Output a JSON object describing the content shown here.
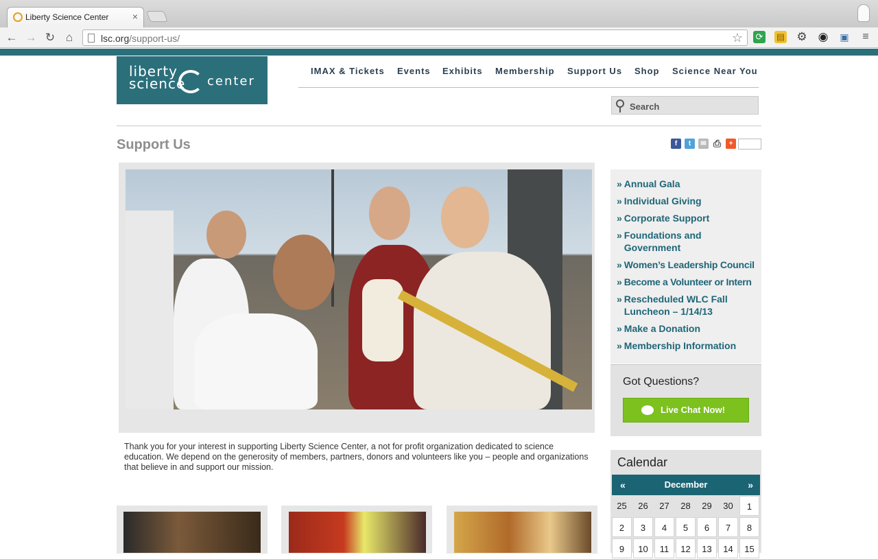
{
  "browser": {
    "tab_title": "Liberty Science Center",
    "tab_close": "×",
    "url_host": "lsc.org",
    "url_path": "/support-us/"
  },
  "site": {
    "logo": {
      "line1": "liberty",
      "line2": "science",
      "line3": "center"
    },
    "nav": [
      "IMAX & Tickets",
      "Events",
      "Exhibits",
      "Membership",
      "Support Us",
      "Shop",
      "Science Near You"
    ],
    "search_placeholder": "Search"
  },
  "page": {
    "title": "Support Us",
    "intro": "Thank you for your interest in supporting Liberty Science Center, a not for profit organization dedicated to science education. We depend on the generosity of members, partners, donors and volunteers like you – people and organizations that believe in and support our mission."
  },
  "share": {
    "icons": [
      "facebook-icon",
      "twitter-icon",
      "email-icon",
      "print-icon",
      "addthis-icon"
    ],
    "labels": [
      "f",
      "t",
      "✉",
      "⎙",
      "+"
    ],
    "colors": [
      "#3b5998",
      "#4fa3d9",
      "#b9b9b9",
      "#555555",
      "#f1592a"
    ]
  },
  "sidebar": {
    "links": [
      "Annual Gala",
      "Individual Giving",
      "Corporate Support",
      "Foundations and Government",
      "Women’s Leadership Council",
      "Become a Volunteer or Intern",
      "Rescheduled WLC Fall Luncheon – 1/14/13",
      "Make a Donation",
      "Membership Information"
    ],
    "raquo": "»",
    "questions_title": "Got Questions?",
    "chat_label": "Live Chat Now!"
  },
  "calendar": {
    "title": "Calendar",
    "month": "December",
    "prev": "«",
    "next": "»",
    "rows": [
      [
        "25",
        "26",
        "27",
        "28",
        "29",
        "30",
        "1"
      ],
      [
        "2",
        "3",
        "4",
        "5",
        "6",
        "7",
        "8"
      ],
      [
        "9",
        "10",
        "11",
        "12",
        "13",
        "14",
        "15"
      ]
    ]
  },
  "colors": {
    "brand_teal": "#2b6f7b",
    "link_teal": "#1e6678",
    "chat_green": "#7cc11e"
  }
}
